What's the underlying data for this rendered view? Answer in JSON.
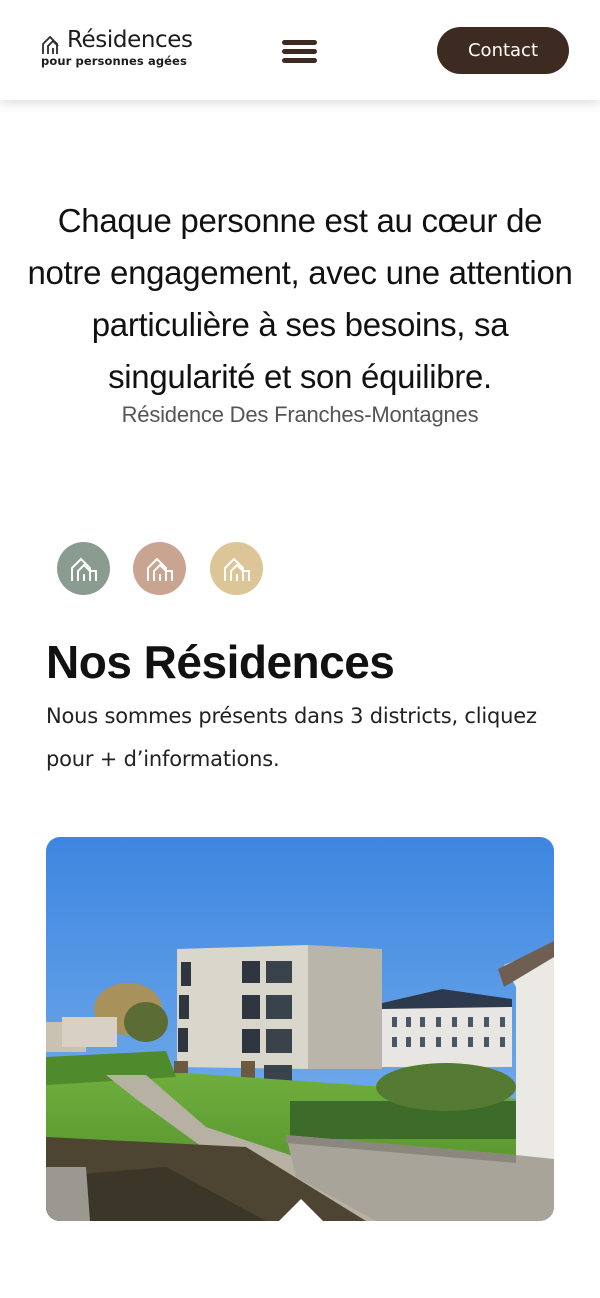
{
  "header": {
    "logo_title": "Résidences",
    "logo_subtitle": "pour personnes agées",
    "logo_icon": "house-outline-icon",
    "menu_icon": "hamburger-menu-icon",
    "contact_label": "Contact",
    "contact_color": "#3d2b22"
  },
  "intro": {
    "text": "Chaque personne est au cœur de notre engagement, avec une attention particulière à ses besoins, sa singularité et son équilibre."
  },
  "icons": [
    {
      "name": "house-icon-green",
      "color": "#8a9c90"
    },
    {
      "name": "house-icon-rose",
      "color": "#c9a491"
    },
    {
      "name": "house-icon-sand",
      "color": "#dcc597"
    }
  ],
  "residences": {
    "title": "Nos Résidences",
    "subtitle": "Nous sommes présents dans 3 districts, cliquez pour + d’informations.",
    "items": [
      {
        "name": "Résidence Des Franches-Montagnes"
      }
    ]
  }
}
